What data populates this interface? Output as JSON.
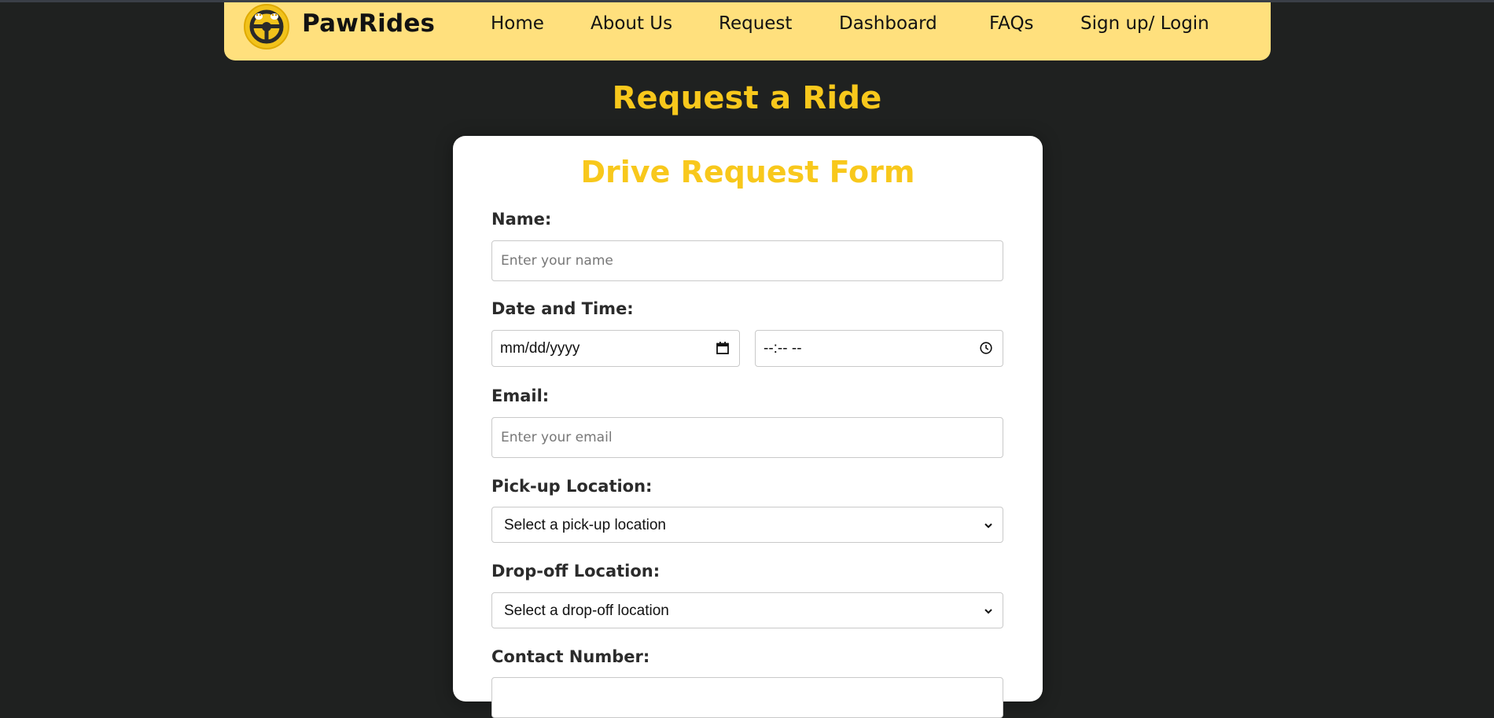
{
  "brand": {
    "name": "PawRides",
    "logo_icon": "steering-wheel-paw-icon"
  },
  "nav": {
    "items": [
      {
        "label": "Home"
      },
      {
        "label": "About Us"
      },
      {
        "label": "Request"
      },
      {
        "label": "Dashboard"
      },
      {
        "label": "FAQs"
      },
      {
        "label": "Sign up/ Login"
      }
    ]
  },
  "page": {
    "title": "Request a Ride"
  },
  "form": {
    "title": "Drive Request Form",
    "name_label": "Name:",
    "name_placeholder": "Enter your name",
    "datetime_label": "Date and Time:",
    "date_value": "mm/dd/yyyy",
    "time_value": "--:-- --",
    "email_label": "Email:",
    "email_placeholder": "Enter your email",
    "pickup_label": "Pick-up Location:",
    "pickup_selected": "Select a pick-up location",
    "dropoff_label": "Drop-off Location:",
    "dropoff_selected": "Select a drop-off location",
    "contact_label": "Contact Number:"
  },
  "colors": {
    "background": "#1f2120",
    "navbar": "#ffe07d",
    "accent": "#f8c81c",
    "card": "#ffffff"
  }
}
